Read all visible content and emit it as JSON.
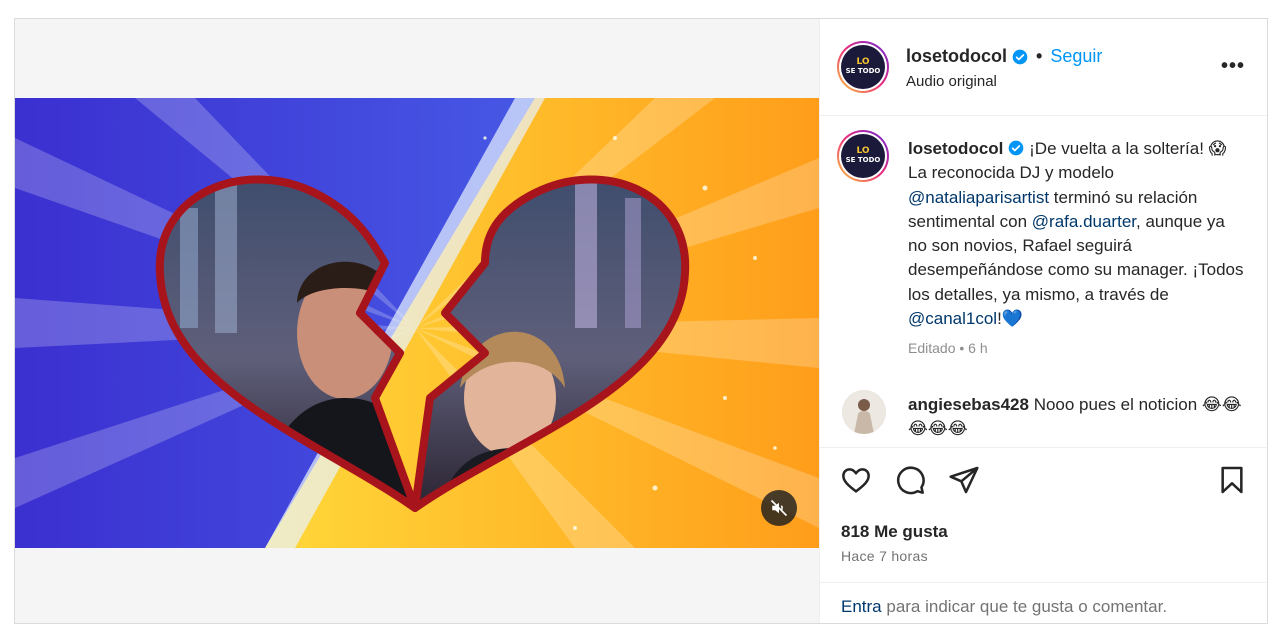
{
  "header": {
    "username": "losetodocol",
    "follow_label": "Seguir",
    "separator": "•",
    "audio": "Audio original",
    "more": "•••"
  },
  "caption": {
    "username": "losetodocol",
    "text_1": " ¡De vuelta a la soltería! 😱 La reconocida DJ y modelo ",
    "mention_1": "@nataliaparisartist",
    "text_2": " terminó su relación sentimental con ",
    "mention_2": "@rafa.duarter",
    "text_3": ", aunque ya no son novios, Rafael seguirá desempeñándose como su manager. ¡Todos los detalles, ya mismo, a través de ",
    "mention_3": "@canal1col",
    "text_4": "!💙",
    "meta": "Editado • 6 h"
  },
  "comment": {
    "username": "angiesebas428",
    "text": " Nooo pues el noticion 😂😂😂😂😂"
  },
  "actions": {
    "likes": "818 Me gusta",
    "time": "Hace 7 horas"
  },
  "add_comment": {
    "enter": "Entra",
    "rest": " para indicar que te gusta o comentar."
  },
  "colors": {
    "link_blue": "#0095f6",
    "mention": "#00376b",
    "muted": "#737373",
    "border": "#dbdbdb"
  }
}
